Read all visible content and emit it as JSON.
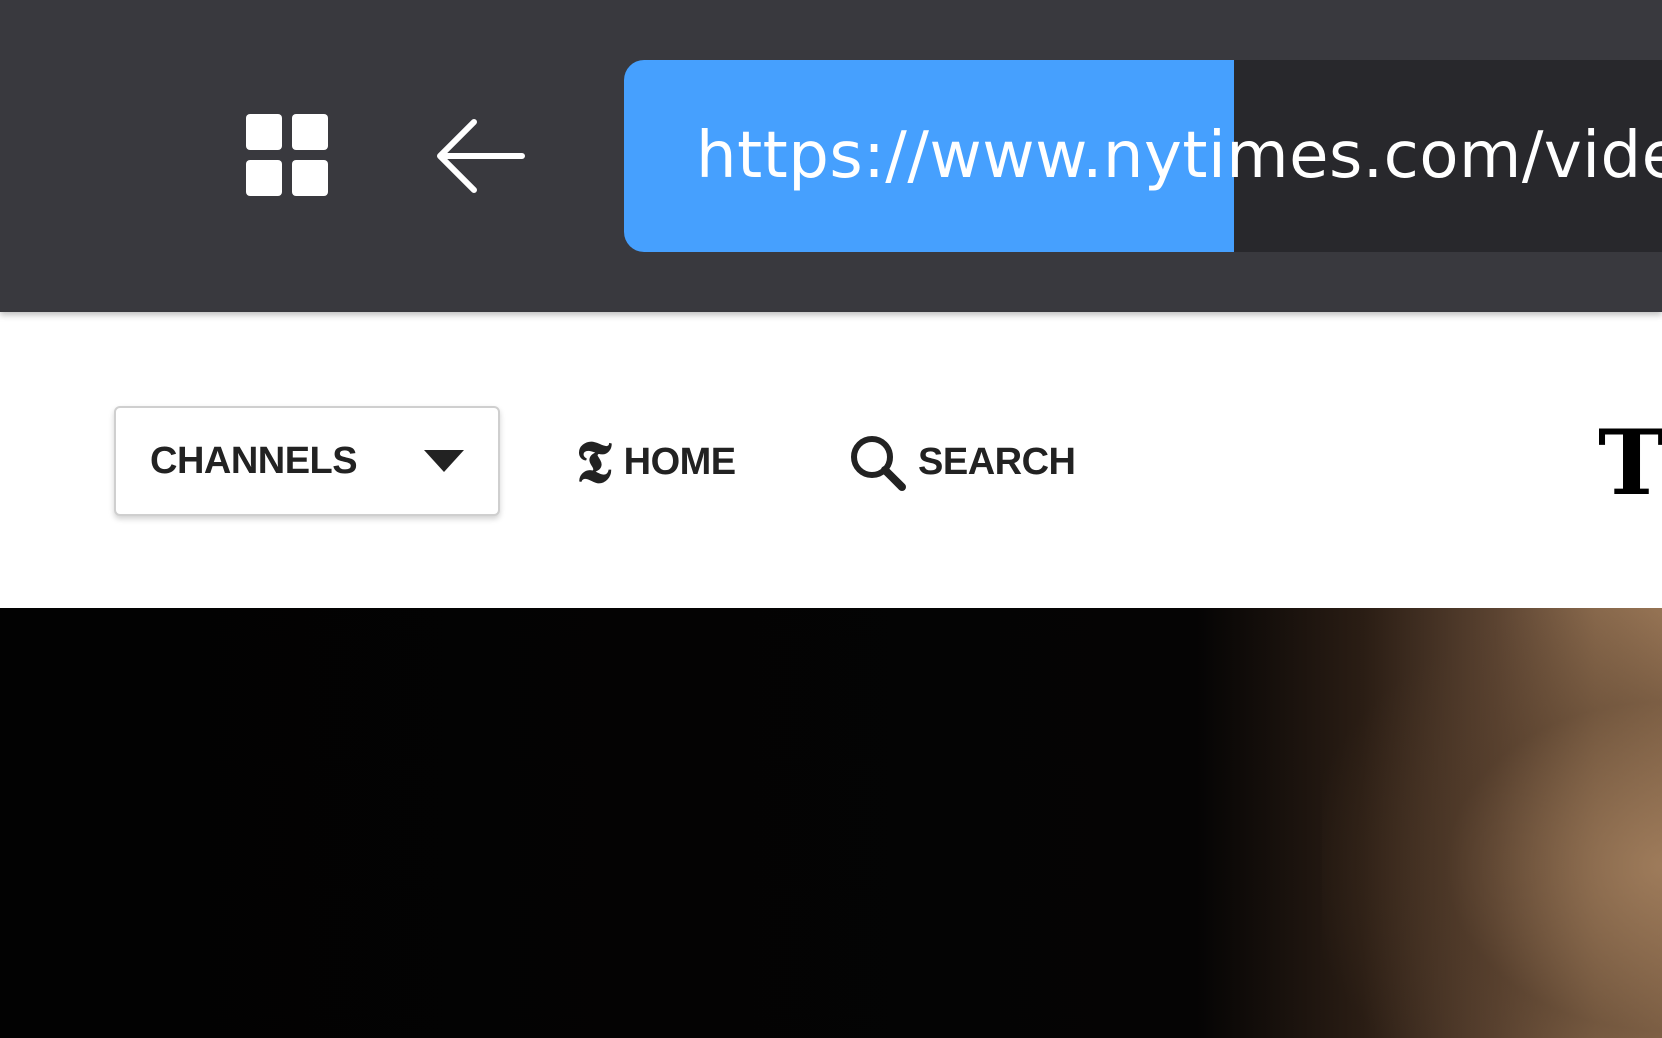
{
  "browser": {
    "url": "https://www.nytimes.com/video",
    "icons": {
      "apps": "apps-grid-icon",
      "back": "back-arrow-icon"
    },
    "colors": {
      "bar": "#39393e",
      "url_field": "#28282c",
      "selection": "#46a0fe"
    }
  },
  "header": {
    "channels_label": "CHANNELS",
    "home_label": "HOME",
    "search_label": "SEARCH",
    "logo_letter": "T",
    "home_icon_glyph": "𝕿",
    "icons": {
      "caret": "caret-down-icon",
      "home": "nyt-t-icon",
      "search": "search-icon"
    }
  },
  "video": {
    "colors": {
      "background": "#020202",
      "accent": "#9a7757"
    }
  }
}
